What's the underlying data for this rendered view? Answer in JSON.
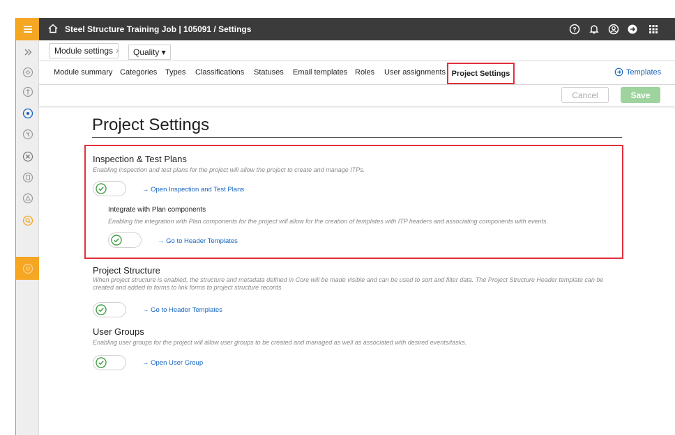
{
  "header": {
    "breadcrumb": "Steel Structure Training Job | 105091  /  Settings"
  },
  "module_bar": {
    "module_settings_label": "Module settings",
    "module_selected": "Quality ▾"
  },
  "tabs": [
    {
      "label": "Module summary"
    },
    {
      "label": "Categories"
    },
    {
      "label": "Types"
    },
    {
      "label": "Classifications"
    },
    {
      "label": "Statuses"
    },
    {
      "label": "Email templates"
    },
    {
      "label": "Roles"
    },
    {
      "label": "User assignments"
    },
    {
      "label": "Project Settings",
      "active": true
    }
  ],
  "templates_link": "Templates",
  "actions": {
    "cancel_label": "Cancel",
    "save_label": "Save"
  },
  "page": {
    "title": "Project Settings"
  },
  "sections": {
    "itp": {
      "title": "Inspection & Test Plans",
      "description": "Enabling inspection and test plans for the project will allow the project to create and manage ITPs.",
      "link": "→ Open Inspection and Test Plans",
      "enabled": true
    },
    "plan_integration": {
      "title": "Integrate with Plan components",
      "description": "Enabling the integration with Plan components for the project will allow for the creation of templates with ITP headers and associating components with events.",
      "link": "→ Go to Header Templates",
      "enabled": true
    },
    "project_structure": {
      "title": "Project Structure",
      "description": "When project structure is enabled, the structure and metadata defined in Core will be made visible and can be used to sort and filter data. The Project Structure Header template can be created and added to forms to link forms to project structure records.",
      "link": "→ Go to Header Templates",
      "enabled": true
    },
    "user_groups": {
      "title": "User Groups",
      "description": "Enabling user groups for the project will allow user groups to be created and managed as well as associated with desired events/tasks.",
      "link": "→ Open User Group",
      "enabled": true
    }
  },
  "colors": {
    "accent": "#f5a623",
    "topbar": "#3b3b3b",
    "highlight": "#e0313b",
    "link": "#1565c0",
    "toggle_on": "#43a047",
    "save_disabled": "#9ed39e"
  }
}
